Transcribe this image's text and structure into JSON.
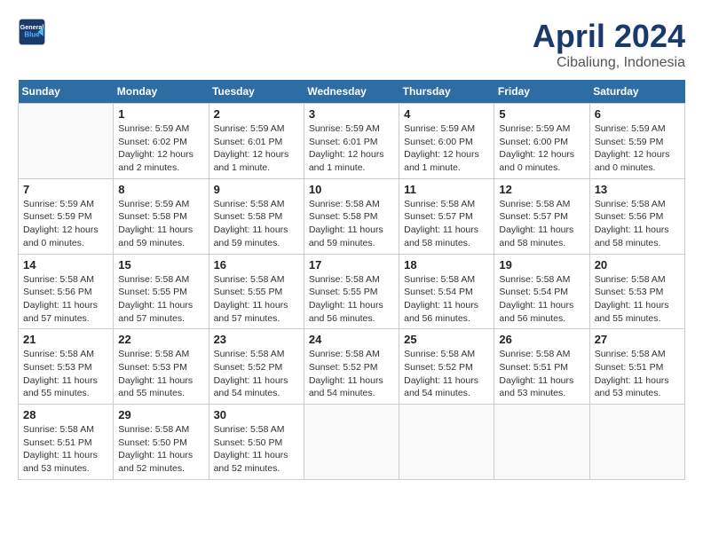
{
  "header": {
    "logo_line1": "General",
    "logo_line2": "Blue",
    "month": "April 2024",
    "location": "Cibaliung, Indonesia"
  },
  "days_of_week": [
    "Sunday",
    "Monday",
    "Tuesday",
    "Wednesday",
    "Thursday",
    "Friday",
    "Saturday"
  ],
  "weeks": [
    [
      {
        "day": "",
        "sunrise": "",
        "sunset": "",
        "daylight": ""
      },
      {
        "day": "1",
        "sunrise": "Sunrise: 5:59 AM",
        "sunset": "Sunset: 6:02 PM",
        "daylight": "Daylight: 12 hours and 2 minutes."
      },
      {
        "day": "2",
        "sunrise": "Sunrise: 5:59 AM",
        "sunset": "Sunset: 6:01 PM",
        "daylight": "Daylight: 12 hours and 1 minute."
      },
      {
        "day": "3",
        "sunrise": "Sunrise: 5:59 AM",
        "sunset": "Sunset: 6:01 PM",
        "daylight": "Daylight: 12 hours and 1 minute."
      },
      {
        "day": "4",
        "sunrise": "Sunrise: 5:59 AM",
        "sunset": "Sunset: 6:00 PM",
        "daylight": "Daylight: 12 hours and 1 minute."
      },
      {
        "day": "5",
        "sunrise": "Sunrise: 5:59 AM",
        "sunset": "Sunset: 6:00 PM",
        "daylight": "Daylight: 12 hours and 0 minutes."
      },
      {
        "day": "6",
        "sunrise": "Sunrise: 5:59 AM",
        "sunset": "Sunset: 5:59 PM",
        "daylight": "Daylight: 12 hours and 0 minutes."
      }
    ],
    [
      {
        "day": "7",
        "sunrise": "Sunrise: 5:59 AM",
        "sunset": "Sunset: 5:59 PM",
        "daylight": "Daylight: 12 hours and 0 minutes."
      },
      {
        "day": "8",
        "sunrise": "Sunrise: 5:59 AM",
        "sunset": "Sunset: 5:58 PM",
        "daylight": "Daylight: 11 hours and 59 minutes."
      },
      {
        "day": "9",
        "sunrise": "Sunrise: 5:58 AM",
        "sunset": "Sunset: 5:58 PM",
        "daylight": "Daylight: 11 hours and 59 minutes."
      },
      {
        "day": "10",
        "sunrise": "Sunrise: 5:58 AM",
        "sunset": "Sunset: 5:58 PM",
        "daylight": "Daylight: 11 hours and 59 minutes."
      },
      {
        "day": "11",
        "sunrise": "Sunrise: 5:58 AM",
        "sunset": "Sunset: 5:57 PM",
        "daylight": "Daylight: 11 hours and 58 minutes."
      },
      {
        "day": "12",
        "sunrise": "Sunrise: 5:58 AM",
        "sunset": "Sunset: 5:57 PM",
        "daylight": "Daylight: 11 hours and 58 minutes."
      },
      {
        "day": "13",
        "sunrise": "Sunrise: 5:58 AM",
        "sunset": "Sunset: 5:56 PM",
        "daylight": "Daylight: 11 hours and 58 minutes."
      }
    ],
    [
      {
        "day": "14",
        "sunrise": "Sunrise: 5:58 AM",
        "sunset": "Sunset: 5:56 PM",
        "daylight": "Daylight: 11 hours and 57 minutes."
      },
      {
        "day": "15",
        "sunrise": "Sunrise: 5:58 AM",
        "sunset": "Sunset: 5:55 PM",
        "daylight": "Daylight: 11 hours and 57 minutes."
      },
      {
        "day": "16",
        "sunrise": "Sunrise: 5:58 AM",
        "sunset": "Sunset: 5:55 PM",
        "daylight": "Daylight: 11 hours and 57 minutes."
      },
      {
        "day": "17",
        "sunrise": "Sunrise: 5:58 AM",
        "sunset": "Sunset: 5:55 PM",
        "daylight": "Daylight: 11 hours and 56 minutes."
      },
      {
        "day": "18",
        "sunrise": "Sunrise: 5:58 AM",
        "sunset": "Sunset: 5:54 PM",
        "daylight": "Daylight: 11 hours and 56 minutes."
      },
      {
        "day": "19",
        "sunrise": "Sunrise: 5:58 AM",
        "sunset": "Sunset: 5:54 PM",
        "daylight": "Daylight: 11 hours and 56 minutes."
      },
      {
        "day": "20",
        "sunrise": "Sunrise: 5:58 AM",
        "sunset": "Sunset: 5:53 PM",
        "daylight": "Daylight: 11 hours and 55 minutes."
      }
    ],
    [
      {
        "day": "21",
        "sunrise": "Sunrise: 5:58 AM",
        "sunset": "Sunset: 5:53 PM",
        "daylight": "Daylight: 11 hours and 55 minutes."
      },
      {
        "day": "22",
        "sunrise": "Sunrise: 5:58 AM",
        "sunset": "Sunset: 5:53 PM",
        "daylight": "Daylight: 11 hours and 55 minutes."
      },
      {
        "day": "23",
        "sunrise": "Sunrise: 5:58 AM",
        "sunset": "Sunset: 5:52 PM",
        "daylight": "Daylight: 11 hours and 54 minutes."
      },
      {
        "day": "24",
        "sunrise": "Sunrise: 5:58 AM",
        "sunset": "Sunset: 5:52 PM",
        "daylight": "Daylight: 11 hours and 54 minutes."
      },
      {
        "day": "25",
        "sunrise": "Sunrise: 5:58 AM",
        "sunset": "Sunset: 5:52 PM",
        "daylight": "Daylight: 11 hours and 54 minutes."
      },
      {
        "day": "26",
        "sunrise": "Sunrise: 5:58 AM",
        "sunset": "Sunset: 5:51 PM",
        "daylight": "Daylight: 11 hours and 53 minutes."
      },
      {
        "day": "27",
        "sunrise": "Sunrise: 5:58 AM",
        "sunset": "Sunset: 5:51 PM",
        "daylight": "Daylight: 11 hours and 53 minutes."
      }
    ],
    [
      {
        "day": "28",
        "sunrise": "Sunrise: 5:58 AM",
        "sunset": "Sunset: 5:51 PM",
        "daylight": "Daylight: 11 hours and 53 minutes."
      },
      {
        "day": "29",
        "sunrise": "Sunrise: 5:58 AM",
        "sunset": "Sunset: 5:50 PM",
        "daylight": "Daylight: 11 hours and 52 minutes."
      },
      {
        "day": "30",
        "sunrise": "Sunrise: 5:58 AM",
        "sunset": "Sunset: 5:50 PM",
        "daylight": "Daylight: 11 hours and 52 minutes."
      },
      {
        "day": "",
        "sunrise": "",
        "sunset": "",
        "daylight": ""
      },
      {
        "day": "",
        "sunrise": "",
        "sunset": "",
        "daylight": ""
      },
      {
        "day": "",
        "sunrise": "",
        "sunset": "",
        "daylight": ""
      },
      {
        "day": "",
        "sunrise": "",
        "sunset": "",
        "daylight": ""
      }
    ]
  ]
}
